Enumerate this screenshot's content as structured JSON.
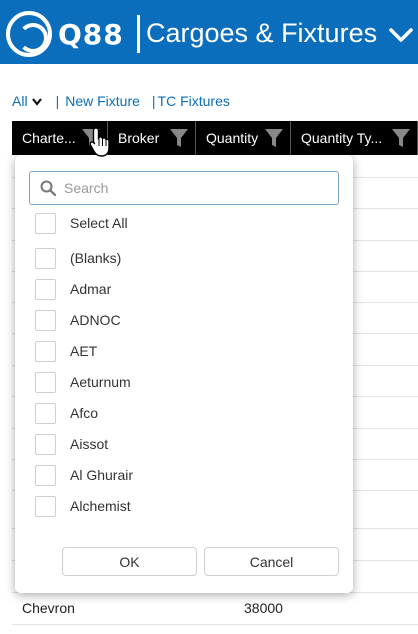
{
  "header": {
    "logo_text": "Q88",
    "title": "Cargoes & Fixtures",
    "bg_color": "#0a6ebd"
  },
  "toolbar": {
    "all_label": "All",
    "new_fixture": "New Fixture",
    "tc_fixtures": "TC Fixtures",
    "separator": "|"
  },
  "grid": {
    "columns": [
      "Charte...",
      "Broker",
      "Quantity",
      "Quantity Ty..."
    ],
    "visible_row": {
      "charterer": "Chevron",
      "quantity": "38000"
    }
  },
  "filter_popup": {
    "search_placeholder": "Search",
    "select_all": "Select All",
    "options": [
      "(Blanks)",
      "Admar",
      "ADNOC",
      "AET",
      "Aeturnum",
      "Afco",
      "Aissot",
      "Al Ghurair",
      "Alchemist"
    ],
    "ok_label": "OK",
    "cancel_label": "Cancel"
  }
}
